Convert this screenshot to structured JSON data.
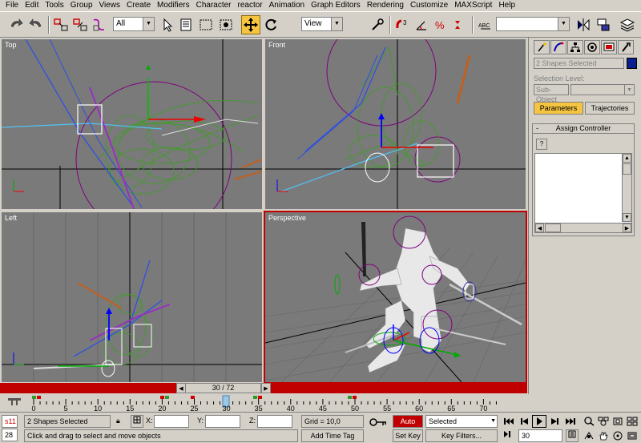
{
  "menu": [
    "File",
    "Edit",
    "Tools",
    "Group",
    "Views",
    "Create",
    "Modifiers",
    "Character",
    "reactor",
    "Animation",
    "Graph Editors",
    "Rendering",
    "Customize",
    "MAXScript",
    "Help"
  ],
  "toolbar": {
    "selection_filter": "All",
    "ref_coord": "View",
    "named_selection": "",
    "icons": [
      "undo-icon",
      "redo-icon",
      "link-icon",
      "unlink-icon",
      "bind-space-warp-icon",
      "select-object-icon",
      "select-by-name-icon",
      "rect-region-icon",
      "window-crossing-icon",
      "select-move-icon",
      "select-rotate-icon",
      "select-scale-icon",
      "pivot-icon",
      "manipulate-icon",
      "snap-3d-icon",
      "angle-snap-icon",
      "percent-snap-icon",
      "spinner-snap-icon",
      "edit-named-sel-icon",
      "mirror-icon",
      "align-icon",
      "layer-manager-icon"
    ]
  },
  "viewports": {
    "top": "Top",
    "front": "Front",
    "left": "Left",
    "perspective": "Perspective"
  },
  "command_panel": {
    "tabs": [
      "create-tab",
      "modify-tab",
      "hierarchy-tab",
      "motion-tab",
      "display-tab",
      "utilities-tab"
    ],
    "name_field": "2 Shapes Selected",
    "object_color": "#0a1e8c",
    "selection_level_label": "Selection Level:",
    "sub_object": "Sub-Object",
    "tab_parameters": "Parameters",
    "tab_trajectories": "Trajectories",
    "rollout_minus": "-",
    "rollout_title": "Assign Controller",
    "question_btn": "?"
  },
  "time_slider": {
    "label": "30 / 72",
    "position": 0.4167
  },
  "trackbar": {
    "ticks": [
      "0",
      "5",
      "10",
      "15",
      "20",
      "25",
      "30",
      "35",
      "40",
      "45",
      "50",
      "55",
      "60",
      "65",
      "70"
    ]
  },
  "status": {
    "listener_top": "s11",
    "listener_bottom": "28",
    "selection_info": "2 Shapes Selected",
    "x_label": "X:",
    "y_label": "Y:",
    "z_label": "Z:",
    "x_value": "",
    "y_value": "",
    "z_value": "",
    "grid": "Grid = 10,0",
    "prompt": "Click and drag to select and move objects",
    "add_time_tag": "Add Time Tag",
    "auto_key": "Auto Key",
    "set_key": "Set Key",
    "key_mode": "Selected",
    "key_filters": "Key Filters...",
    "current_frame": "30"
  }
}
